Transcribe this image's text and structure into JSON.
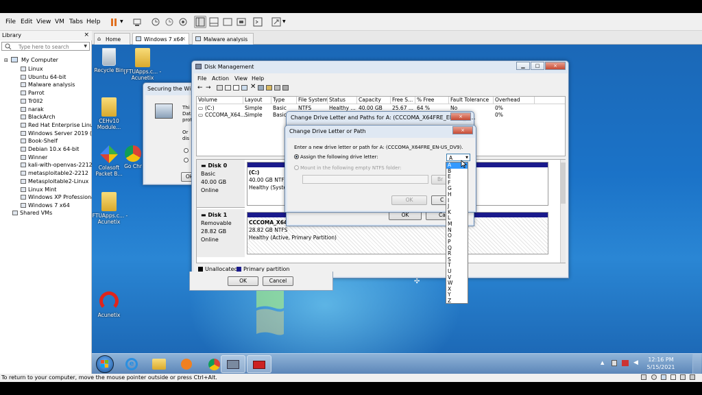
{
  "menubar": {
    "items": [
      "File",
      "Edit",
      "View",
      "VM",
      "Tabs",
      "Help"
    ]
  },
  "library": {
    "title": "Library",
    "search_placeholder": "Type here to search",
    "root": "My Computer",
    "vms": [
      "Linux",
      "Ubuntu 64-bit",
      "Malware analysis",
      "Parrot",
      "Tr0ll2",
      "narak",
      "BlackArch",
      "Red Hat Enterprise Linux",
      "Windows Server 2019 (3)",
      "Book-Shelf",
      "Debian 10.x 64-bit",
      "Winner",
      "kali-with-openvas-2212",
      "metasploitable2-2212",
      "Metasploitable2-Linux",
      "Linux Mint",
      "Windows XP Professional",
      "Windows 7 x64"
    ],
    "shared": "Shared VMs"
  },
  "tabs": [
    {
      "label": "Home"
    },
    {
      "label": "Windows 7 x64"
    },
    {
      "label": "Malware analysis"
    }
  ],
  "desktop_icons": [
    {
      "label": "Recycle Bin"
    },
    {
      "label": "[FTUApps.c... - Acunetix"
    },
    {
      "label": "CEHv10 Module..."
    },
    {
      "label": "Colasoft Packet B..."
    },
    {
      "label": "Go Chr"
    },
    {
      "label": "[FTUApps.c... - Acunetix"
    },
    {
      "label": "Acunetix"
    }
  ],
  "securing_window": {
    "title": "Securing the Wind",
    "text_lines": [
      "Thi",
      "Data",
      "prot",
      "Or",
      "dis"
    ],
    "ok_label": "Ok"
  },
  "disk_management": {
    "title": "Disk Management",
    "menu": [
      "File",
      "Action",
      "View",
      "Help"
    ],
    "columns": [
      "Volume",
      "Layout",
      "Type",
      "File System",
      "Status",
      "Capacity",
      "Free S...",
      "% Free",
      "Fault Tolerance",
      "Overhead"
    ],
    "rows": [
      [
        "(C:)",
        "Simple",
        "Basic",
        "NTFS",
        "Healthy ...",
        "40.00 GB",
        "25.67 ...",
        "64 %",
        "No",
        "0%"
      ],
      [
        "CCCOMA_X64...",
        "Simple",
        "Basic",
        "",
        "",
        "",
        "",
        "",
        "",
        "0%"
      ]
    ],
    "disks": [
      {
        "name": "Disk 0",
        "kind": "Basic",
        "size": "40.00 GB",
        "state": "Online",
        "part_label": "(C:)",
        "part_size": "40.00 GB NTFS",
        "part_status": "Healthy (System"
      },
      {
        "name": "Disk 1",
        "kind": "Removable",
        "size": "28.82 GB",
        "state": "Online",
        "part_label": "CCCOMA_X64F",
        "part_size": "28.82 GB NTFS",
        "part_status": "Healthy (Active, Primary Partition)"
      }
    ],
    "legend": [
      "Unallocated",
      "Primary partition"
    ],
    "colors": {
      "unallocated": "#000000",
      "primary": "#1a1a8c"
    }
  },
  "change_paths_window": {
    "title": "Change Drive Letter and Paths for A: (CCCOMA_X64FRE_EN-US_D...",
    "ok_label": "OK",
    "cancel_label": "Ca"
  },
  "change_letter_dialog": {
    "title": "Change Drive Letter or Path",
    "instruction": "Enter a new drive letter or path for A: (CCCOMA_X64FRE_EN-US_DV9).",
    "option_assign": "Assign the following drive letter:",
    "option_mount": "Mount in the following empty NTFS folder:",
    "browse_label": "Br",
    "ok_label": "OK",
    "cancel_label": "C",
    "selected_letter": "A",
    "letters": [
      "A",
      "B",
      "E",
      "F",
      "G",
      "H",
      "I",
      "J",
      "K",
      "L",
      "M",
      "N",
      "O",
      "P",
      "Q",
      "R",
      "S",
      "T",
      "U",
      "V",
      "W",
      "X",
      "Y",
      "Z"
    ]
  },
  "outer_dialog_buttons": {
    "ok": "OK",
    "cancel": "Cancel"
  },
  "tray": {
    "time": "12:16 PM",
    "date": "5/15/2021"
  },
  "status_text": "To return to your computer, move the mouse pointer outside or press Ctrl+Alt."
}
